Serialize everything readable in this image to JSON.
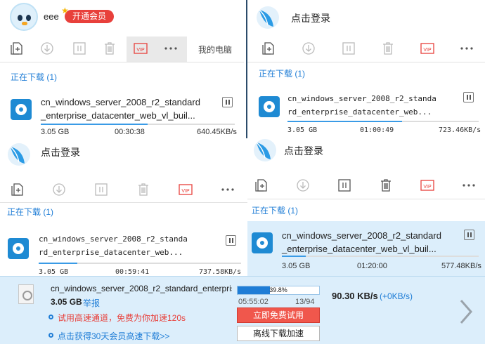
{
  "panel1": {
    "username": "eee",
    "vip_button": "开通会员",
    "my_computer": "我的电脑",
    "section": "正在下载 (1)",
    "file_line1": "cn_windows_server_2008_r2_standard",
    "file_line2": "_enterprise_datacenter_web_vl_buil...",
    "size": "3.05 GB",
    "elapsed": "00:30:38",
    "speed": "640.45KB/s",
    "progress": 0.55
  },
  "panel2": {
    "login": "点击登录",
    "section": "正在下载 (1)",
    "file_line1": "cn_windows_server_2008_r2_standa",
    "file_line2": "rd_enterprise_datacenter_web...",
    "size": "3.05 GB",
    "elapsed": "01:00:49",
    "speed": "723.46KB/s",
    "progress": 0.6
  },
  "panel3": {
    "login": "点击登录",
    "section": "正在下载 (1)",
    "file_line1": "cn_windows_server_2008_r2_standa",
    "file_line2": "rd_enterprise_datacenter_web...",
    "size": "3.05 GB",
    "elapsed": "00:59:41",
    "speed": "737.58KB/s",
    "progress": 0.19
  },
  "panel4": {
    "login": "点击登录",
    "section": "正在下载 (1)",
    "file_line1": "cn_windows_server_2008_r2_standard",
    "file_line2": "_enterprise_datacenter_web_vl_buil...",
    "size": "3.05 GB",
    "elapsed": "01:20:00",
    "speed": "577.48KB/s",
    "progress": 0.12
  },
  "bottom": {
    "filename": "cn_windows_server_2008_r2_standard_enterpris...",
    "size": "3.05 GB",
    "report": "举报",
    "percent_text": "39.8%",
    "progress": 0.398,
    "time": "05:55:02",
    "count": "13/94",
    "speed": "90.30  KB/s",
    "speed_delta": "(+0KB/s)",
    "trial_text": "试用高速通道，免费为你加速120s",
    "vip_text": "点击获得30天会员高速下载>>",
    "trial_button": "立即免费试用",
    "offline_button": "离线下载加速"
  },
  "colors": {
    "accent": "#1f7dd6",
    "red": "#e8403b",
    "highlight": "#dceefb"
  }
}
